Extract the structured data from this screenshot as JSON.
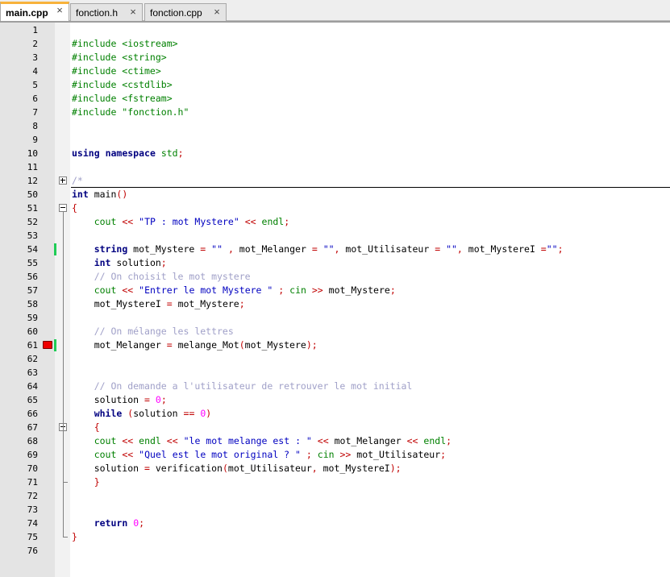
{
  "tabs": [
    {
      "label": "main.cpp",
      "active": true,
      "close": "×"
    },
    {
      "label": "fonction.h",
      "active": false,
      "close": "×"
    },
    {
      "label": "fonction.cpp",
      "active": false,
      "close": "×"
    }
  ],
  "colors": {
    "active_tab_accent": "#f7b23b",
    "change_marker": "#1fcc56",
    "bookmark": "#ee0000"
  },
  "lines": [
    {
      "n": "1",
      "code": ""
    },
    {
      "n": "2",
      "code": "#include <iostream>"
    },
    {
      "n": "3",
      "code": "#include <string>"
    },
    {
      "n": "4",
      "code": "#include <ctime>"
    },
    {
      "n": "5",
      "code": "#include <cstdlib>"
    },
    {
      "n": "6",
      "code": "#include <fstream>"
    },
    {
      "n": "7",
      "code": "#include \"fonction.h\""
    },
    {
      "n": "8",
      "code": ""
    },
    {
      "n": "9",
      "code": ""
    },
    {
      "n": "10",
      "code": "using namespace std;"
    },
    {
      "n": "11",
      "code": ""
    },
    {
      "n": "12",
      "code": "/*"
    },
    {
      "n": "50",
      "code": "int main()"
    },
    {
      "n": "51",
      "code": "{"
    },
    {
      "n": "52",
      "code": "    cout << \"TP : mot Mystere\" << endl;"
    },
    {
      "n": "53",
      "code": ""
    },
    {
      "n": "54",
      "code": "    string mot_Mystere = \"\" , mot_Melanger = \"\", mot_Utilisateur = \"\", mot_MystereI =\"\";"
    },
    {
      "n": "55",
      "code": "    int solution;"
    },
    {
      "n": "56",
      "code": "    // On choisit le mot mystere"
    },
    {
      "n": "57",
      "code": "    cout << \"Entrer le mot Mystere \" ; cin >> mot_Mystere;"
    },
    {
      "n": "58",
      "code": "    mot_MystereI = mot_Mystere;"
    },
    {
      "n": "59",
      "code": ""
    },
    {
      "n": "60",
      "code": "    // On mélange les lettres"
    },
    {
      "n": "61",
      "code": "    mot_Melanger = melange_Mot(mot_Mystere);"
    },
    {
      "n": "62",
      "code": ""
    },
    {
      "n": "63",
      "code": ""
    },
    {
      "n": "64",
      "code": "    // On demande a l'utilisateur de retrouver le mot initial"
    },
    {
      "n": "65",
      "code": "    solution = 0;"
    },
    {
      "n": "66",
      "code": "    while (solution == 0)"
    },
    {
      "n": "67",
      "code": "    {"
    },
    {
      "n": "68",
      "code": "    cout << endl << \"le mot melange est : \" << mot_Melanger << endl;"
    },
    {
      "n": "69",
      "code": "    cout << \"Quel est le mot original ? \" ; cin >> mot_Utilisateur;"
    },
    {
      "n": "70",
      "code": "    solution = verification(mot_Utilisateur, mot_MystereI);"
    },
    {
      "n": "71",
      "code": "    }"
    },
    {
      "n": "72",
      "code": ""
    },
    {
      "n": "73",
      "code": ""
    },
    {
      "n": "74",
      "code": "    return 0;"
    },
    {
      "n": "75",
      "code": "}"
    },
    {
      "n": "76",
      "code": ""
    }
  ]
}
